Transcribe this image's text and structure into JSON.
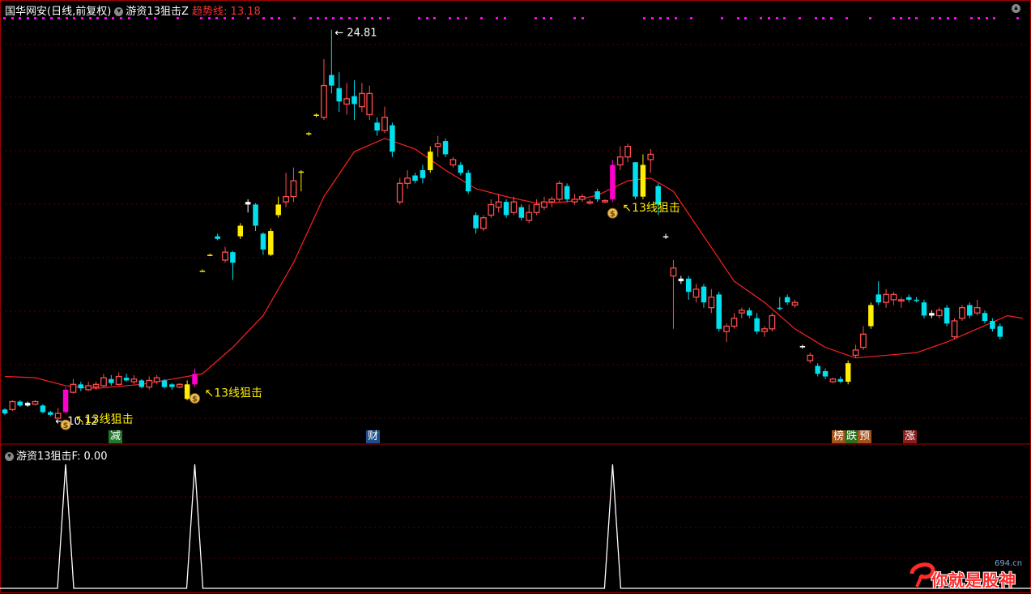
{
  "header": {
    "stock_label": "国华网安(日线,前复权)",
    "indicator_name": "游资13狙击Z",
    "trend_label": "趋势线:",
    "trend_value": "13.18"
  },
  "sub_header": {
    "indicator_label": "游资13狙击F",
    "value": ": 0.00"
  },
  "annotations": {
    "high_price": "24.81",
    "low_price": "10.12",
    "signal_text": "13线狙击"
  },
  "event_tags": [
    {
      "text": "减",
      "bg": "#1f7a2a"
    },
    {
      "text": "财",
      "bg": "#1c4f8c"
    },
    {
      "text": "榜",
      "bg": "#a4521a"
    },
    {
      "text": "跌",
      "bg": "#2c6e1e"
    },
    {
      "text": "预",
      "bg": "#a4521a"
    },
    {
      "text": "涨",
      "bg": "#8c1c1c"
    }
  ],
  "colors": {
    "up": "#ff4d4d",
    "down": "#00e0ee",
    "signal_up": "#ffee00",
    "signal_mag": "#ff00cc",
    "trend": "#ff2020",
    "grid": "#5a0000",
    "divider": "#a00000",
    "dots": "#ff00ff",
    "label": "#ffee00",
    "trend_text": "#ff3030",
    "price_text": "#ffffff"
  },
  "watermark": {
    "text": "你就是股神",
    "site": "694.cn"
  },
  "chart_data": {
    "type": "candlestick",
    "y_range": [
      10.0,
      25.2
    ],
    "candles": [
      [
        10.3,
        10.45,
        10.25,
        10.5,
        "d"
      ],
      [
        10.45,
        10.75,
        10.4,
        10.8,
        "u"
      ],
      [
        10.75,
        10.6,
        10.55,
        10.8,
        "d"
      ],
      [
        10.6,
        10.7,
        10.55,
        10.75,
        "w"
      ],
      [
        10.65,
        10.75,
        10.6,
        10.8,
        "u"
      ],
      [
        10.6,
        10.35,
        10.3,
        10.65,
        "d"
      ],
      [
        10.35,
        10.25,
        10.2,
        10.4,
        "d"
      ],
      [
        10.12,
        10.3,
        10.12,
        10.5,
        "u"
      ],
      [
        10.35,
        11.2,
        10.3,
        11.3,
        "m"
      ],
      [
        11.1,
        11.4,
        11.05,
        11.6,
        "u"
      ],
      [
        11.4,
        11.25,
        11.15,
        11.5,
        "d"
      ],
      [
        11.2,
        11.35,
        11.15,
        11.5,
        "u"
      ],
      [
        11.3,
        11.4,
        11.2,
        11.5,
        "u"
      ],
      [
        11.35,
        11.65,
        11.3,
        11.8,
        "u"
      ],
      [
        11.6,
        11.45,
        11.35,
        11.75,
        "d"
      ],
      [
        11.4,
        11.7,
        11.35,
        11.85,
        "u"
      ],
      [
        11.65,
        11.55,
        11.5,
        11.8,
        "d"
      ],
      [
        11.5,
        11.6,
        11.4,
        11.75,
        "u"
      ],
      [
        11.55,
        11.3,
        11.25,
        11.6,
        "d"
      ],
      [
        11.3,
        11.55,
        11.2,
        11.7,
        "u"
      ],
      [
        11.5,
        11.65,
        11.4,
        11.75,
        "u"
      ],
      [
        11.55,
        11.3,
        11.25,
        11.6,
        "d"
      ],
      [
        11.3,
        11.4,
        11.2,
        11.45,
        "d"
      ],
      [
        11.4,
        11.3,
        11.25,
        11.45,
        "u"
      ],
      [
        10.85,
        11.4,
        10.8,
        11.55,
        "y"
      ],
      [
        11.4,
        11.8,
        11.3,
        12.0,
        "m"
      ],
      [
        15.7,
        15.7,
        15.65,
        15.75,
        "y"
      ],
      [
        16.3,
        16.3,
        16.25,
        16.35,
        "y"
      ],
      [
        17.0,
        16.9,
        16.85,
        17.1,
        "d"
      ],
      [
        16.1,
        16.4,
        16.0,
        16.6,
        "u"
      ],
      [
        16.4,
        16.0,
        15.35,
        16.45,
        "d"
      ],
      [
        17.0,
        17.4,
        16.9,
        17.5,
        "y"
      ],
      [
        18.3,
        18.2,
        17.9,
        18.4,
        "w"
      ],
      [
        18.2,
        17.4,
        17.2,
        18.25,
        "d"
      ],
      [
        17.1,
        16.5,
        16.3,
        17.15,
        "d"
      ],
      [
        16.3,
        17.2,
        16.25,
        17.3,
        "y"
      ],
      [
        17.8,
        18.2,
        17.7,
        18.5,
        "y"
      ],
      [
        18.3,
        18.5,
        18.1,
        19.4,
        "u"
      ],
      [
        18.5,
        19.1,
        18.3,
        19.6,
        "u"
      ],
      [
        19.45,
        19.45,
        18.7,
        19.5,
        "y"
      ],
      [
        20.9,
        20.9,
        20.8,
        20.95,
        "y"
      ],
      [
        21.6,
        21.6,
        21.5,
        21.65,
        "y"
      ],
      [
        21.5,
        22.7,
        21.4,
        23.7,
        "u"
      ],
      [
        22.7,
        23.1,
        22.4,
        24.81,
        "d"
      ],
      [
        22.6,
        22.1,
        21.7,
        23.2,
        "d"
      ],
      [
        22.0,
        22.2,
        21.6,
        22.8,
        "u"
      ],
      [
        22.3,
        22.0,
        21.4,
        22.9,
        "d"
      ],
      [
        21.9,
        22.4,
        21.7,
        22.8,
        "u"
      ],
      [
        22.4,
        21.6,
        21.4,
        22.7,
        "u"
      ],
      [
        21.3,
        21.0,
        20.8,
        21.5,
        "d"
      ],
      [
        21.0,
        21.5,
        20.9,
        21.9,
        "u"
      ],
      [
        21.2,
        20.2,
        20.0,
        21.3,
        "d"
      ],
      [
        18.3,
        19.0,
        18.2,
        19.2,
        "u"
      ],
      [
        19.0,
        19.2,
        18.8,
        19.5,
        "u"
      ],
      [
        19.3,
        19.1,
        19.0,
        19.4,
        "d"
      ],
      [
        19.2,
        19.5,
        19.0,
        19.7,
        "d"
      ],
      [
        19.5,
        20.2,
        19.4,
        20.4,
        "y"
      ],
      [
        20.5,
        20.4,
        20.0,
        20.8,
        "u"
      ],
      [
        20.6,
        20.1,
        20.0,
        20.7,
        "d"
      ],
      [
        19.7,
        19.9,
        19.6,
        20.0,
        "u"
      ],
      [
        19.7,
        19.4,
        19.3,
        19.8,
        "d"
      ],
      [
        19.4,
        18.7,
        18.6,
        19.5,
        "d"
      ],
      [
        17.8,
        17.3,
        17.1,
        17.9,
        "d"
      ],
      [
        17.3,
        17.7,
        17.2,
        17.8,
        "u"
      ],
      [
        17.8,
        18.2,
        17.7,
        18.4,
        "u"
      ],
      [
        18.1,
        18.3,
        17.9,
        18.6,
        "u"
      ],
      [
        18.3,
        17.8,
        17.7,
        18.4,
        "d"
      ],
      [
        17.9,
        18.3,
        17.8,
        18.5,
        "u"
      ],
      [
        18.1,
        17.7,
        17.6,
        18.2,
        "d"
      ],
      [
        17.6,
        17.9,
        17.5,
        18.2,
        "u"
      ],
      [
        17.9,
        18.2,
        17.8,
        18.4,
        "u"
      ],
      [
        18.1,
        18.3,
        18.0,
        18.5,
        "u"
      ],
      [
        18.3,
        18.4,
        18.1,
        18.5,
        "u"
      ],
      [
        18.4,
        19.0,
        18.3,
        19.1,
        "u"
      ],
      [
        18.9,
        18.4,
        18.3,
        19.0,
        "d"
      ],
      [
        18.3,
        18.4,
        18.2,
        18.6,
        "u"
      ],
      [
        18.4,
        18.5,
        18.3,
        18.6,
        "u"
      ],
      [
        18.3,
        18.3,
        18.2,
        18.4,
        "u"
      ],
      [
        18.7,
        18.4,
        18.3,
        18.8,
        "d"
      ],
      [
        18.3,
        18.35,
        18.25,
        18.4,
        "u"
      ],
      [
        18.4,
        19.7,
        18.3,
        19.9,
        "m"
      ],
      [
        19.7,
        20.0,
        19.5,
        20.4,
        "u"
      ],
      [
        20.0,
        20.4,
        19.8,
        20.5,
        "u"
      ],
      [
        19.8,
        18.5,
        18.4,
        19.8,
        "d"
      ],
      [
        18.5,
        19.7,
        18.4,
        20.1,
        "y"
      ],
      [
        19.9,
        20.1,
        19.4,
        20.3,
        "u"
      ],
      [
        18.9,
        18.2,
        17.8,
        19.0,
        "d"
      ],
      [
        17.0,
        17.0,
        16.9,
        17.1,
        "w"
      ],
      [
        15.5,
        15.8,
        13.5,
        16.1,
        "u"
      ],
      [
        15.4,
        15.3,
        15.2,
        15.5,
        "w"
      ],
      [
        15.4,
        14.9,
        14.6,
        15.5,
        "d"
      ],
      [
        14.7,
        15.0,
        14.5,
        15.2,
        "u"
      ],
      [
        15.1,
        14.5,
        14.3,
        15.2,
        "d"
      ],
      [
        14.7,
        14.3,
        14.1,
        15.0,
        "u"
      ],
      [
        14.8,
        13.5,
        13.4,
        14.9,
        "d"
      ],
      [
        13.4,
        13.6,
        13.0,
        13.7,
        "u"
      ],
      [
        13.6,
        13.9,
        13.5,
        14.1,
        "u"
      ],
      [
        14.1,
        14.2,
        13.9,
        14.3,
        "u"
      ],
      [
        14.2,
        14.0,
        13.9,
        14.3,
        "d"
      ],
      [
        13.9,
        13.4,
        13.3,
        14.1,
        "d"
      ],
      [
        13.4,
        13.5,
        13.2,
        13.6,
        "u"
      ],
      [
        13.5,
        14.0,
        13.4,
        14.1,
        "u"
      ],
      [
        14.3,
        14.3,
        14.2,
        14.7,
        "d"
      ],
      [
        14.5,
        14.7,
        14.4,
        14.8,
        "d"
      ],
      [
        14.4,
        14.5,
        14.3,
        14.6,
        "u"
      ],
      [
        12.8,
        12.85,
        12.75,
        12.9,
        "w"
      ],
      [
        12.3,
        12.5,
        12.2,
        12.6,
        "u"
      ],
      [
        12.1,
        11.8,
        11.7,
        12.2,
        "d"
      ],
      [
        11.9,
        11.7,
        11.6,
        12.0,
        "d"
      ],
      [
        11.6,
        11.5,
        11.45,
        11.65,
        "u"
      ],
      [
        11.5,
        11.6,
        11.45,
        11.7,
        "d"
      ],
      [
        11.5,
        12.2,
        11.4,
        12.3,
        "y"
      ],
      [
        12.5,
        12.7,
        12.4,
        12.9,
        "u"
      ],
      [
        12.8,
        13.3,
        12.7,
        13.6,
        "u"
      ],
      [
        13.6,
        14.4,
        13.5,
        14.5,
        "y"
      ],
      [
        14.5,
        14.8,
        14.4,
        15.3,
        "d"
      ],
      [
        14.8,
        14.5,
        14.3,
        15.0,
        "u"
      ],
      [
        14.6,
        14.8,
        14.4,
        14.9,
        "u"
      ],
      [
        14.6,
        14.6,
        14.3,
        14.7,
        "u"
      ],
      [
        14.7,
        14.6,
        14.5,
        14.8,
        "d"
      ],
      [
        14.6,
        14.6,
        14.5,
        14.7,
        "d"
      ],
      [
        14.5,
        14.0,
        13.9,
        14.6,
        "d"
      ],
      [
        14.0,
        14.1,
        13.9,
        14.2,
        "w"
      ],
      [
        14.0,
        14.2,
        13.9,
        14.3,
        "u"
      ],
      [
        14.3,
        13.7,
        13.6,
        14.4,
        "d"
      ],
      [
        13.2,
        13.8,
        13.1,
        13.9,
        "u"
      ],
      [
        13.9,
        14.3,
        13.8,
        14.4,
        "u"
      ],
      [
        14.4,
        14.0,
        13.9,
        14.5,
        "d"
      ],
      [
        14.1,
        14.3,
        14.0,
        14.6,
        "u"
      ],
      [
        14.1,
        13.8,
        13.7,
        14.2,
        "d"
      ],
      [
        13.8,
        13.5,
        13.4,
        13.9,
        "d"
      ],
      [
        13.6,
        13.2,
        13.1,
        13.7,
        "d"
      ]
    ],
    "trend": [
      [
        0,
        11.7
      ],
      [
        4,
        11.65
      ],
      [
        8,
        11.35
      ],
      [
        12,
        11.25
      ],
      [
        18,
        11.4
      ],
      [
        22,
        11.6
      ],
      [
        26,
        11.8
      ],
      [
        30,
        12.8
      ],
      [
        34,
        14.0
      ],
      [
        38,
        16.0
      ],
      [
        42,
        18.5
      ],
      [
        46,
        20.2
      ],
      [
        50,
        20.7
      ],
      [
        54,
        20.3
      ],
      [
        58,
        19.5
      ],
      [
        62,
        18.8
      ],
      [
        66,
        18.5
      ],
      [
        70,
        18.25
      ],
      [
        74,
        18.3
      ],
      [
        78,
        18.55
      ],
      [
        82,
        19.1
      ],
      [
        85,
        19.2
      ],
      [
        88,
        18.7
      ],
      [
        92,
        17.0
      ],
      [
        96,
        15.3
      ],
      [
        100,
        14.5
      ],
      [
        104,
        13.5
      ],
      [
        108,
        12.8
      ],
      [
        112,
        12.4
      ],
      [
        116,
        12.5
      ],
      [
        120,
        12.6
      ],
      [
        124,
        13.0
      ],
      [
        128,
        13.5
      ],
      [
        132,
        14.0
      ],
      [
        134,
        13.9
      ]
    ],
    "signals": [
      {
        "index": 8,
        "label": "13线狙击"
      },
      {
        "index": 25,
        "label": "13线狙击"
      },
      {
        "index": 80,
        "label": "13线狙击"
      }
    ]
  }
}
